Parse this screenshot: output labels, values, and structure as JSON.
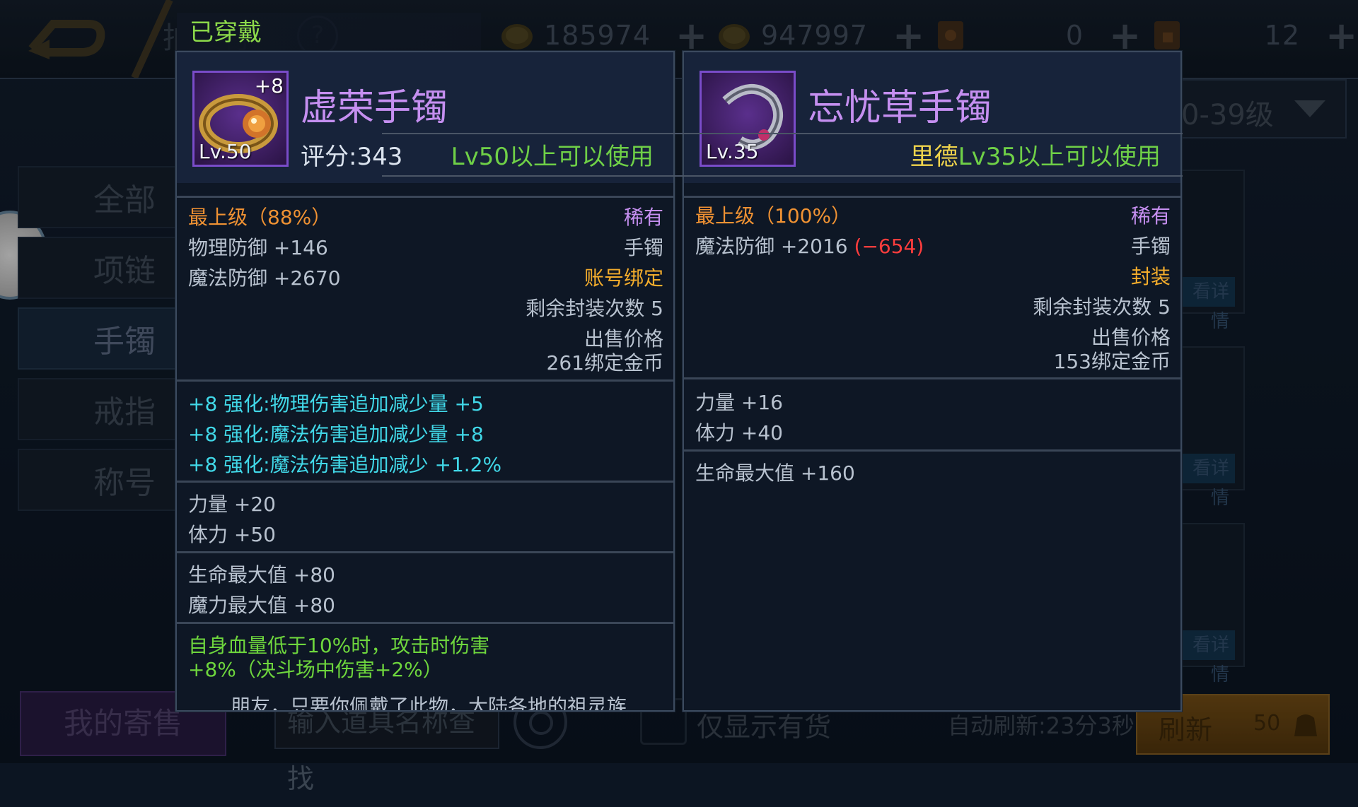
{
  "topbar": {
    "title": "拍卖行",
    "help": "?",
    "currencies": [
      {
        "icon": "gold-coin-icon",
        "value": "185974",
        "plus": "+"
      },
      {
        "icon": "bound-gold-coin-icon",
        "value": "947997",
        "plus": "+"
      },
      {
        "icon": "scroll-star-icon",
        "value": "0",
        "plus": "+"
      },
      {
        "icon": "scroll-lock-icon",
        "value": "12",
        "plus": "+"
      }
    ]
  },
  "sidebar": {
    "items": [
      "全部",
      "项链",
      "手镯",
      "戒指",
      "称号"
    ],
    "active_index": 2
  },
  "filter": {
    "level": "0-39级"
  },
  "list": {
    "detail_label": "看详情"
  },
  "bottom": {
    "my_sale": "我的寄售",
    "search_placeholder": "输入道具名称查找",
    "stock_only": "仅显示有货",
    "auto_refresh": "自动刷新:23分3秒",
    "refresh": "刷新",
    "refresh_cost": "50"
  },
  "equipped_label": "已穿戴",
  "left_item": {
    "plus": "+8",
    "level": "Lv.50",
    "name": "虚荣手镯",
    "score": "评分:343",
    "requirement": "Lv50以上可以使用",
    "grade": "最上级（88%）",
    "rarity": "稀有",
    "stat1": "物理防御 +146",
    "slot": "手镯",
    "stat2": "魔法防御 +2670",
    "bind": "账号绑定",
    "seal_count": "剩余封装次数 5",
    "sell_label": "出售价格",
    "sell_price": "261绑定金币",
    "enhance": [
      "+8 强化:物理伤害追加减少量 +5",
      "+8 强化:魔法伤害追加减少量 +8",
      "+8 强化:魔法伤害追加减少 +1.2%"
    ],
    "attr1": "力量 +20",
    "attr2": "体力 +50",
    "attr3": "生命最大值 +80",
    "attr4": "魔力最大值 +80",
    "special1": "自身血量低于10%时，攻击时伤害",
    "special2": "+8%（决斗场中伤害+2%）",
    "flavor": "朋友，只要你佩戴了此物，大陆各地的祖灵族"
  },
  "right_item": {
    "level": "Lv.35",
    "name": "忘忧草手镯",
    "req_prefix": "里德",
    "requirement": "Lv35以上可以使用",
    "grade": "最上级（100%）",
    "rarity": "稀有",
    "stat1": "魔法防御 +2016",
    "stat1_diff": "(−654)",
    "slot": "手镯",
    "bind": "封装",
    "seal_count": "剩余封装次数 5",
    "sell_label": "出售价格",
    "sell_price": "153绑定金币",
    "attr1": "力量 +16",
    "attr2": "体力 +40",
    "attr3": "生命最大值 +160"
  }
}
